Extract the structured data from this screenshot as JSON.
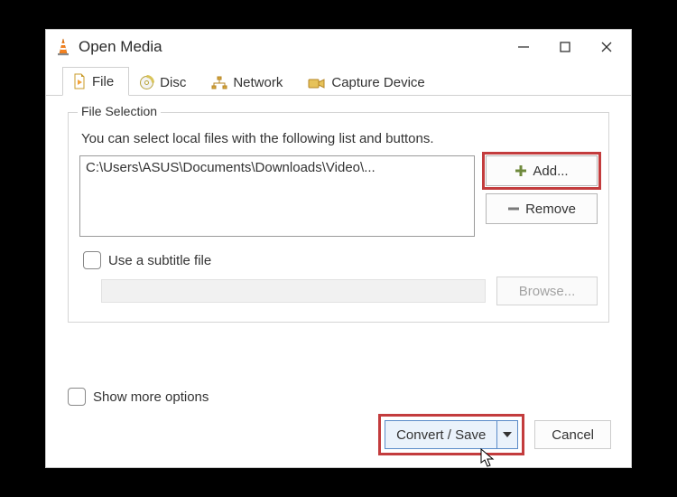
{
  "window": {
    "title": "Open Media"
  },
  "tabs": {
    "file": "File",
    "disc": "Disc",
    "network": "Network",
    "capture": "Capture Device"
  },
  "fileSelection": {
    "legend": "File Selection",
    "help": "You can select local files with the following list and buttons.",
    "path": "C:\\Users\\ASUS\\Documents\\Downloads\\Video\\...",
    "addLabel": "Add...",
    "removeLabel": "Remove"
  },
  "subtitle": {
    "checkboxLabel": "Use a subtitle file",
    "browseLabel": "Browse..."
  },
  "bottom": {
    "showMore": "Show more options"
  },
  "footer": {
    "convert": "Convert / Save",
    "cancel": "Cancel"
  }
}
